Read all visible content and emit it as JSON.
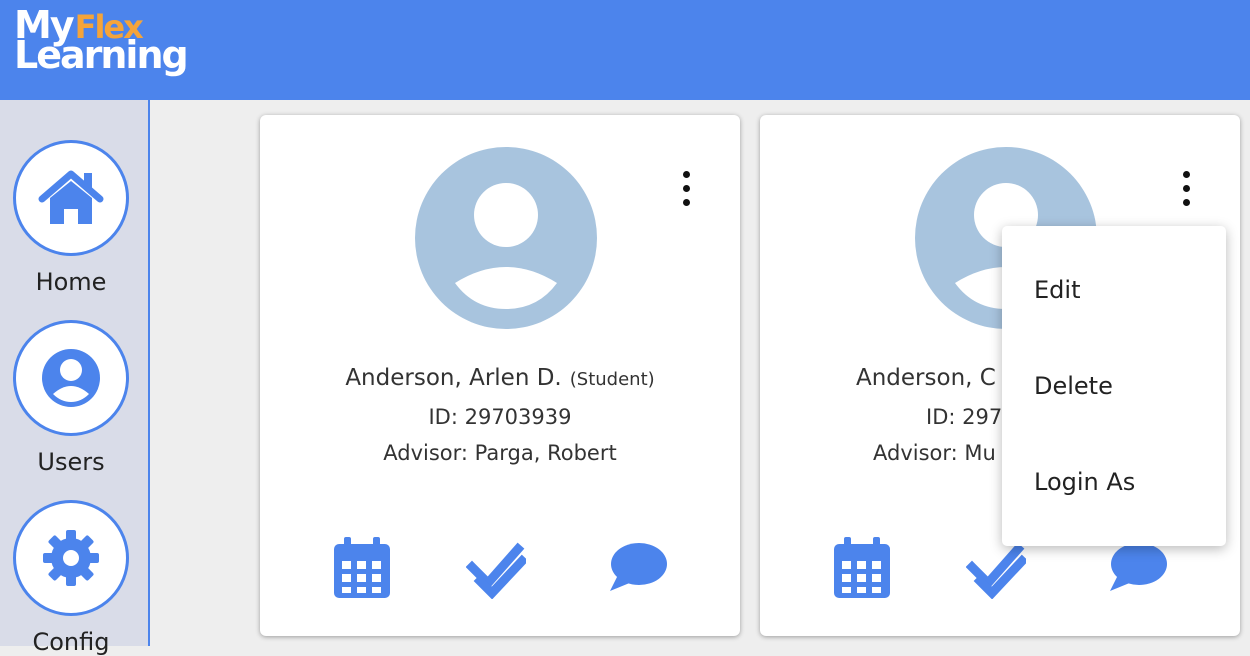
{
  "brand": {
    "logo_my": "My",
    "logo_flex": "Flex",
    "logo_learning": "Learning"
  },
  "sidebar": {
    "items": [
      {
        "label": "Home",
        "icon": "home-icon"
      },
      {
        "label": "Users",
        "icon": "user-icon"
      },
      {
        "label": "Config",
        "icon": "gear-icon"
      }
    ]
  },
  "cards": [
    {
      "name": "Anderson, Arlen D.",
      "role": "(Student)",
      "id": "ID: 29703939",
      "advisor": "Advisor: Parga, Robert"
    },
    {
      "name": "Anderson, C",
      "role": "",
      "id": "ID: 297",
      "advisor": "Advisor: Mu"
    }
  ],
  "context_menu": {
    "items": [
      "Edit",
      "Delete",
      "Login As"
    ]
  },
  "colors": {
    "primary": "#4c84ec",
    "accent": "#f5a43a",
    "avatar": "#a8c4de",
    "sidebar_bg": "#d9dce8"
  }
}
